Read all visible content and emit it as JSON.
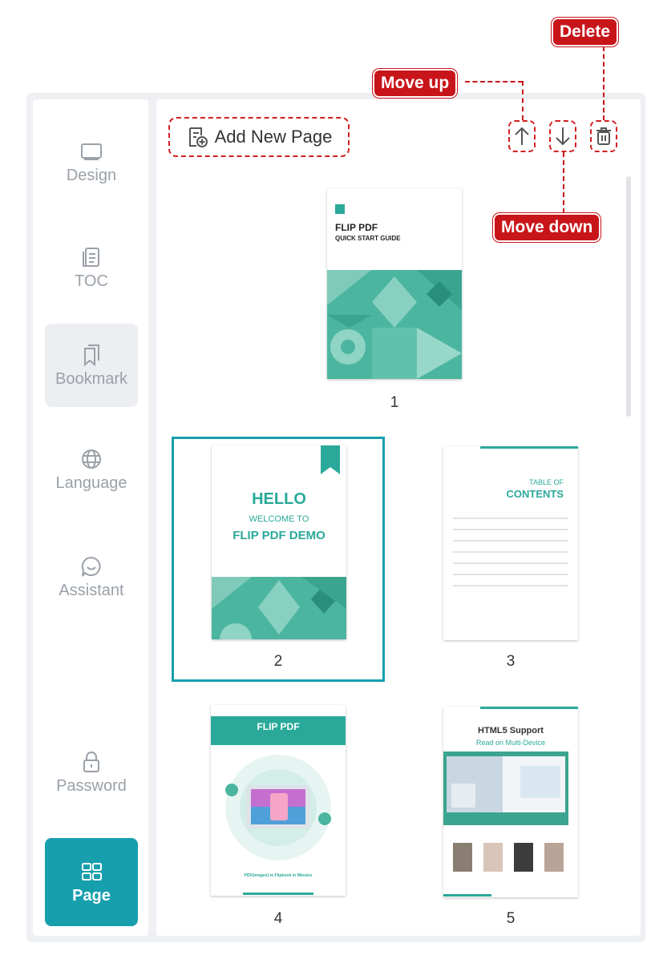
{
  "sidebar": {
    "items": [
      {
        "label": "Design",
        "icon": "monitor-icon"
      },
      {
        "label": "TOC",
        "icon": "toc-icon"
      },
      {
        "label": "Bookmark",
        "icon": "bookmark-icon"
      },
      {
        "label": "Language",
        "icon": "globe-icon"
      },
      {
        "label": "Assistant",
        "icon": "chat-icon"
      },
      {
        "label": "Password",
        "icon": "lock-icon"
      },
      {
        "label": "Page",
        "icon": "grid-icon"
      }
    ]
  },
  "toolbar": {
    "add_page_label": "Add New Page",
    "move_up_icon": "arrow-up-icon",
    "move_down_icon": "arrow-down-icon",
    "delete_icon": "trash-icon"
  },
  "callouts": {
    "delete": "Delete",
    "move_up": "Move up",
    "move_down": "Move down"
  },
  "pages": [
    {
      "number": "1",
      "title": "FLIP PDF",
      "subtitle": "QUICK START GUIDE"
    },
    {
      "number": "2",
      "line1": "HELLO",
      "line2": "WELCOME TO",
      "line3": "FLIP PDF DEMO"
    },
    {
      "number": "3",
      "heading1": "TABLE OF",
      "heading2": "CONTENTS"
    },
    {
      "number": "4",
      "title": "FLIP PDF",
      "footer": "PDF(images) to Flipbook in Minutes"
    },
    {
      "number": "5",
      "title": "HTML5 Support",
      "subtitle": "Read on Multi-Device"
    }
  ],
  "colors": {
    "accent": "#179fae",
    "teal": "#2aa99a",
    "annotation": "#c8151a"
  }
}
